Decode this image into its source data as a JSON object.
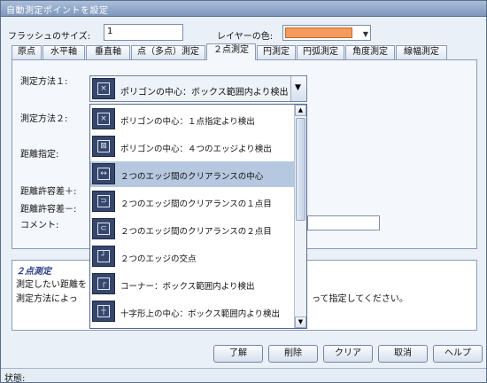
{
  "window": {
    "title": "自動測定ポイントを設定"
  },
  "top": {
    "flash_size_label": "フラッシュのサイズ:",
    "flash_size_value": "1",
    "layer_color_label": "レイヤーの色:",
    "layer_color": "#f39a5c"
  },
  "tabs": [
    "原点",
    "水平軸",
    "垂直軸",
    "点（多点）測定",
    "２点測定",
    "円測定",
    "円弧測定",
    "角度測定",
    "線幅測定"
  ],
  "form": {
    "method1_label": "測定方法１:",
    "method2_label": "測定方法２:",
    "distance_label": "距離指定:",
    "tol_plus_label": "距離許容差＋:",
    "tol_minus_label": "距離許容差－:",
    "comment_label": "コメント:"
  },
  "combo": {
    "selected": "ポリゴンの中心：ボックス範囲内より検出"
  },
  "dropdown": {
    "items": [
      "ポリゴンの中心：１点指定より検出",
      "ポリゴンの中心：４つのエッジより検出",
      "２つのエッジ間のクリアランスの中心",
      "２つのエッジ間のクリアランスの１点目",
      "２つのエッジ間のクリアランスの２点目",
      "２つのエッジの交点",
      "コーナー：ボックス範囲内より検出",
      "十字形上の中心：ボックス範囲内より検出"
    ],
    "selected_index": 2
  },
  "description": {
    "title": "２点測定",
    "line1": "測定したい距離を",
    "line2": "測定方法によっ",
    "line2_end": "って指定してください。"
  },
  "buttons": {
    "ok": "了解",
    "delete": "削除",
    "clear": "クリア",
    "cancel": "取消",
    "help": "ヘルプ"
  },
  "status": {
    "label": "状態:"
  }
}
